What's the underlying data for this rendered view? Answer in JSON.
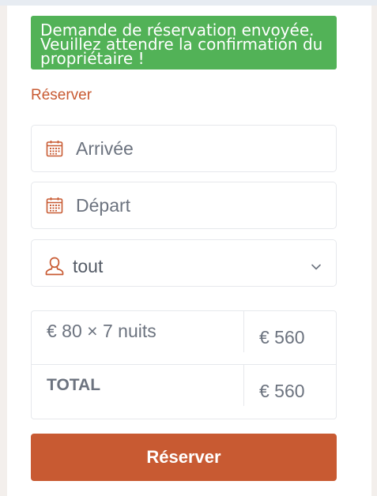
{
  "alert": {
    "message": "Demande de réservation envoyée. Veuillez attendre la confirmation du propriétaire !",
    "color": "#52b257"
  },
  "booking": {
    "title": "Réserver",
    "arrival_placeholder": "Arrivée",
    "departure_placeholder": "Départ",
    "guests_value": "tout",
    "icons": {
      "arrival": "calendar-icon",
      "departure": "calendar-icon",
      "guests": "user-icon",
      "dropdown": "chevron-down-icon"
    }
  },
  "pricing": {
    "rows": [
      {
        "label": "€ 80 × 7 nuits",
        "amount": "€ 560"
      },
      {
        "label": "TOTAL",
        "amount": "€ 560"
      }
    ]
  },
  "submit_label": "Réserver",
  "accent_color": "#c85a32"
}
